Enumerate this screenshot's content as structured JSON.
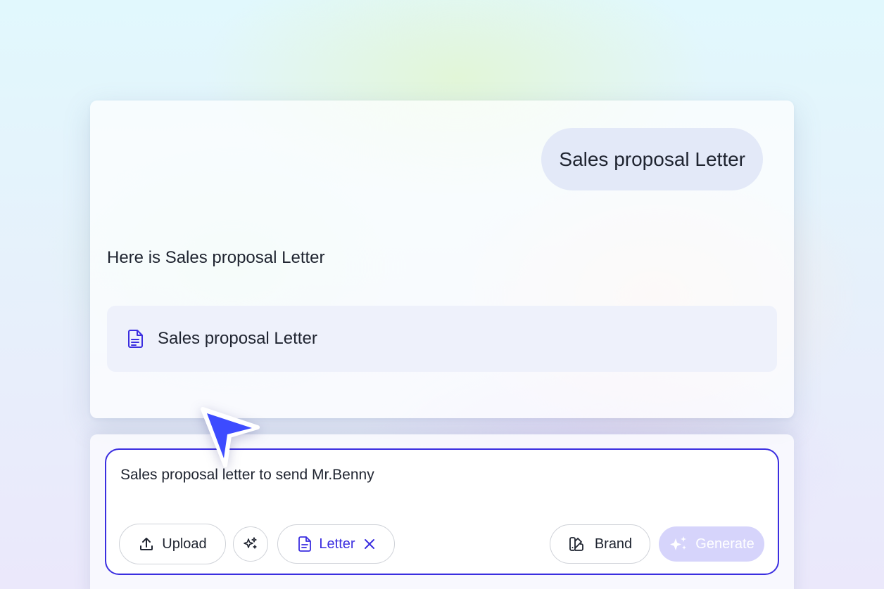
{
  "chat": {
    "user_message": "Sales proposal Letter",
    "assistant_reply": "Here is Sales proposal Letter",
    "document": {
      "title": "Sales proposal Letter",
      "icon": "document-icon"
    }
  },
  "composer": {
    "prompt_value": "Sales proposal letter to send Mr.Benny",
    "upload_label": "Upload",
    "magic_icon": "sparkles-icon",
    "letter_tag_label": "Letter",
    "brand_label": "Brand",
    "generate_label": "Generate"
  },
  "colors": {
    "accent": "#3b2ee0",
    "user_bubble": "#e3e9f8",
    "doc_card": "#eef1fb",
    "generate_disabled": "#d6d4fb",
    "cursor": "#3d4bff"
  }
}
